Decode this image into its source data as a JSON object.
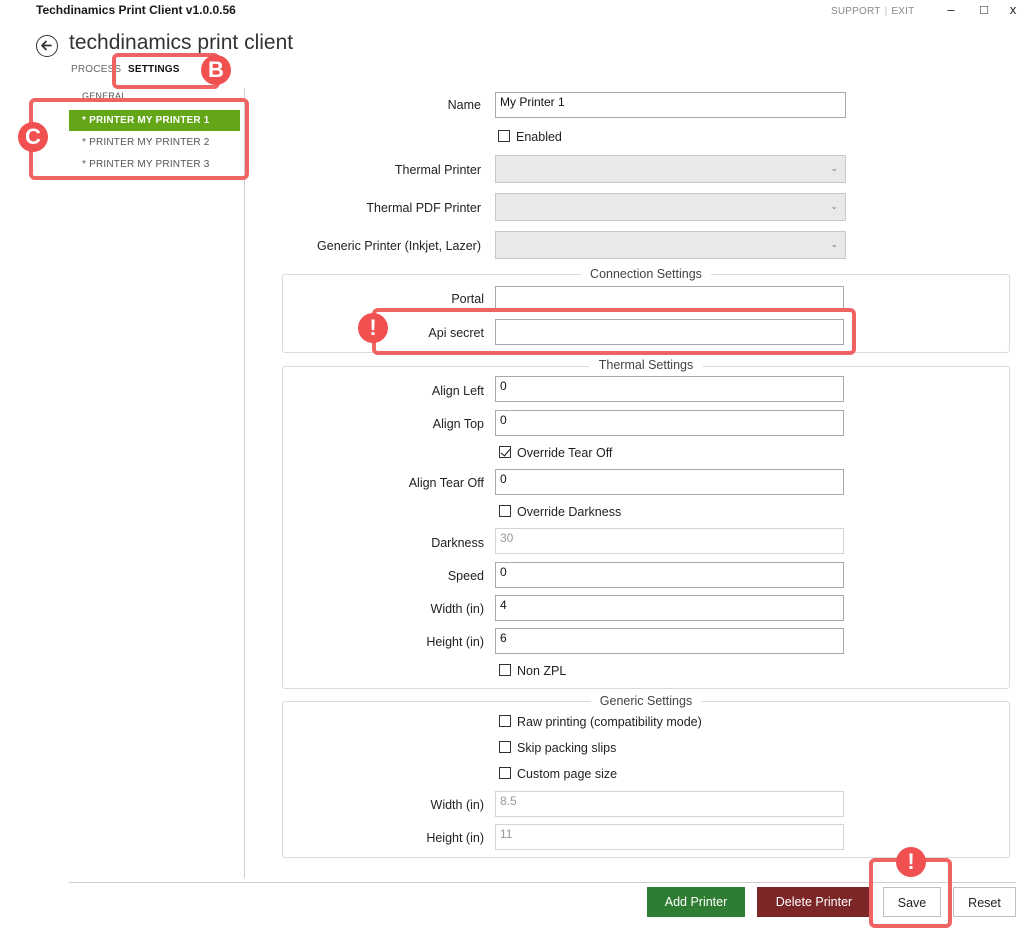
{
  "window": {
    "title": "Techdinamics Print Client v1.0.0.56",
    "links": {
      "support": "SUPPORT",
      "separator": "|",
      "exit": "EXIT"
    },
    "controls": {
      "minimize": "–",
      "maximize": "□",
      "close": "x"
    }
  },
  "header": {
    "app_name": "techdinamics print client",
    "tabs": [
      {
        "label": "PROCESS"
      },
      {
        "label": "SETTINGS"
      }
    ]
  },
  "sidebar": {
    "items": [
      {
        "label": "GENERAL"
      },
      {
        "label": "* PRINTER MY PRINTER 1"
      },
      {
        "label": "* PRINTER MY PRINTER 2"
      },
      {
        "label": "* PRINTER MY PRINTER 3"
      }
    ]
  },
  "form": {
    "name_label": "Name",
    "name_value": "My Printer 1",
    "enabled_label": "Enabled",
    "thermal_printer_label": "Thermal Printer",
    "thermal_pdf_printer_label": "Thermal PDF Printer",
    "generic_printer_label": "Generic Printer (Inkjet, Lazer)",
    "connection": {
      "title": "Connection Settings",
      "portal_label": "Portal",
      "portal_value": "",
      "api_secret_label": "Api secret",
      "api_secret_value": ""
    },
    "thermal": {
      "title": "Thermal Settings",
      "align_left_label": "Align Left",
      "align_left_value": "0",
      "align_top_label": "Align Top",
      "align_top_value": "0",
      "override_tear_off_label": "Override Tear Off",
      "align_tear_off_label": "Align Tear Off",
      "align_tear_off_value": "0",
      "override_darkness_label": "Override Darkness",
      "darkness_label": "Darkness",
      "darkness_value": "30",
      "speed_label": "Speed",
      "speed_value": "0",
      "width_label": "Width (in)",
      "width_value": "4",
      "height_label": "Height (in)",
      "height_value": "6",
      "non_zpl_label": "Non ZPL"
    },
    "generic": {
      "title": "Generic Settings",
      "raw_printing_label": "Raw printing (compatibility mode)",
      "skip_packing_slips_label": "Skip packing slips",
      "custom_page_size_label": "Custom page size",
      "width_label": "Width (in)",
      "width_value": "8.5",
      "height_label": "Height (in)",
      "height_value": "11"
    }
  },
  "actions": {
    "add_printer": "Add Printer",
    "delete_printer": "Delete Printer",
    "save": "Save",
    "reset": "Reset"
  },
  "annotations": {
    "badge_b": "B",
    "badge_c": "C",
    "badge_alert": "!"
  },
  "colors": {
    "active_nav": "#63a618",
    "add_button": "#2f7d32",
    "delete_button": "#7c2628",
    "highlight": "#f06363"
  }
}
